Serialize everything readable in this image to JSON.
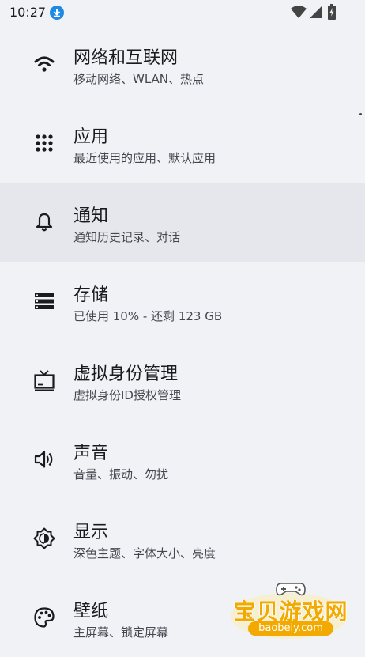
{
  "status_bar": {
    "time": "10:27"
  },
  "settings": [
    {
      "title": "网络和互联网",
      "subtitle": "移动网络、WLAN、热点",
      "icon": "wifi-icon"
    },
    {
      "title": "应用",
      "subtitle": "最近使用的应用、默认应用",
      "icon": "apps-grid-icon"
    },
    {
      "title": "通知",
      "subtitle": "通知历史记录、对话",
      "icon": "bell-icon",
      "pressed": true
    },
    {
      "title": "存储",
      "subtitle": "已使用 10% - 还剩 123 GB",
      "icon": "storage-icon"
    },
    {
      "title": "虚拟身份管理",
      "subtitle": "虚拟身份ID授权管理",
      "icon": "tv-icon"
    },
    {
      "title": "声音",
      "subtitle": "音量、振动、勿扰",
      "icon": "volume-icon"
    },
    {
      "title": "显示",
      "subtitle": "深色主题、字体大小、亮度",
      "icon": "brightness-icon"
    },
    {
      "title": "壁纸",
      "subtitle": "主屏幕、锁定屏幕",
      "icon": "palette-icon"
    }
  ],
  "watermark": {
    "title": "宝贝游戏网",
    "url": "baobeiy.com"
  },
  "colors": {
    "background": "#f1f2f6",
    "pressed_row": "#e6e7ec",
    "download_badge": "#1e88e5",
    "watermark": "#f2a900"
  }
}
